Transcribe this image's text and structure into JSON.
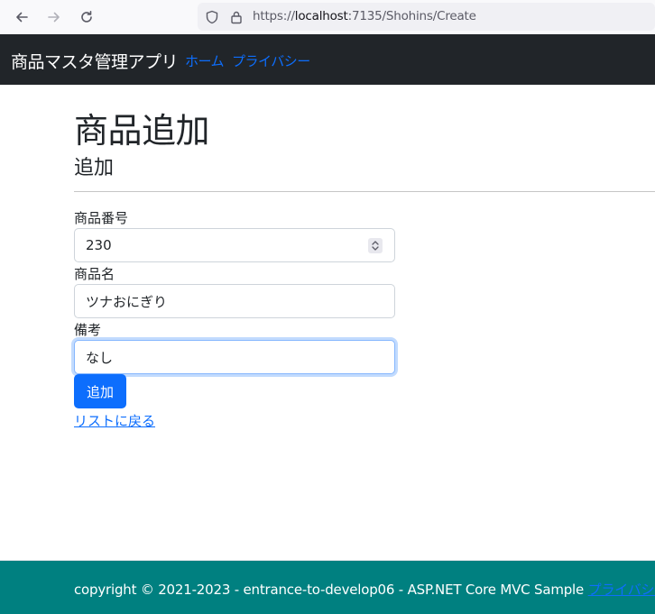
{
  "browser": {
    "url_prefix": "https://",
    "url_host": "localhost",
    "url_rest": ":7135/Shohins/Create"
  },
  "navbar": {
    "brand": "商品マスタ管理アプリ",
    "links": [
      "ホーム",
      "プライバシー"
    ]
  },
  "page": {
    "title": "商品追加",
    "subtitle": "追加"
  },
  "form": {
    "fields": [
      {
        "label": "商品番号",
        "value": "230"
      },
      {
        "label": "商品名",
        "value": "ツナおにぎり"
      },
      {
        "label": "備考",
        "value": "なし"
      }
    ],
    "submit_label": "追加",
    "back_link": "リストに戻る"
  },
  "footer": {
    "text": "copyright © 2021-2023 - entrance-to-develop06 - ASP.NET Core MVC Sample",
    "link": "プライバシー"
  },
  "colors": {
    "navbar_bg": "#212529",
    "primary": "#0d6efd",
    "footer_bg": "#008080"
  },
  "icons": [
    "back-arrow-icon",
    "forward-arrow-icon",
    "reload-icon",
    "shield-icon",
    "lock-icon",
    "spinner-icon"
  ]
}
